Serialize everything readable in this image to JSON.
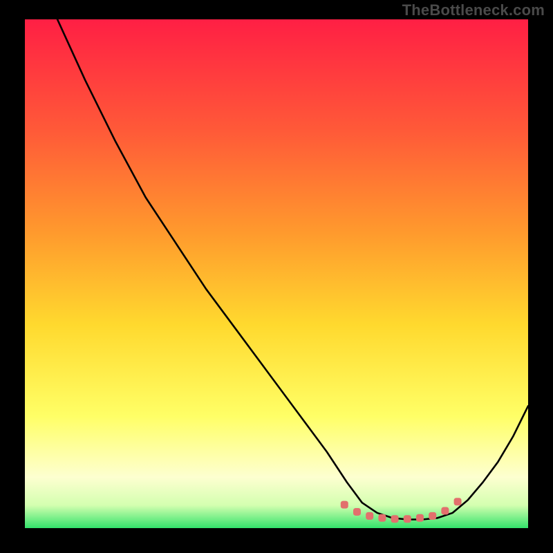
{
  "watermark": "TheBottleneck.com",
  "colors": {
    "frame": "#000000",
    "gradient_top": "#ff1f44",
    "gradient_mid_upper": "#ff8a2b",
    "gradient_mid": "#ffd92e",
    "gradient_mid_lower": "#ffff66",
    "gradient_low": "#fdffd0",
    "gradient_bottom": "#33e36b",
    "curve": "#000000",
    "markers": "#e2706d"
  },
  "chart_data": {
    "type": "line",
    "title": "",
    "xlabel": "",
    "ylabel": "",
    "xlim": [
      0,
      100
    ],
    "ylim": [
      0,
      100
    ],
    "series": [
      {
        "name": "bottleneck-curve",
        "x": [
          0,
          6,
          12,
          18,
          24,
          30,
          36,
          42,
          48,
          54,
          60,
          64,
          67,
          70,
          73,
          76,
          79,
          82,
          85,
          88,
          91,
          94,
          97,
          100
        ],
        "y": [
          116,
          101,
          88,
          76,
          65,
          56,
          47,
          39,
          31,
          23,
          15,
          9,
          5,
          3,
          2,
          1.7,
          1.7,
          2,
          3,
          5.5,
          9,
          13,
          18,
          24
        ]
      }
    ],
    "markers": {
      "name": "highlight-dots",
      "x": [
        63.5,
        66,
        68.5,
        71,
        73.5,
        76,
        78.5,
        81,
        83.5,
        86
      ],
      "y": [
        4.6,
        3.2,
        2.4,
        2.0,
        1.8,
        1.8,
        2.0,
        2.4,
        3.4,
        5.2
      ]
    }
  }
}
